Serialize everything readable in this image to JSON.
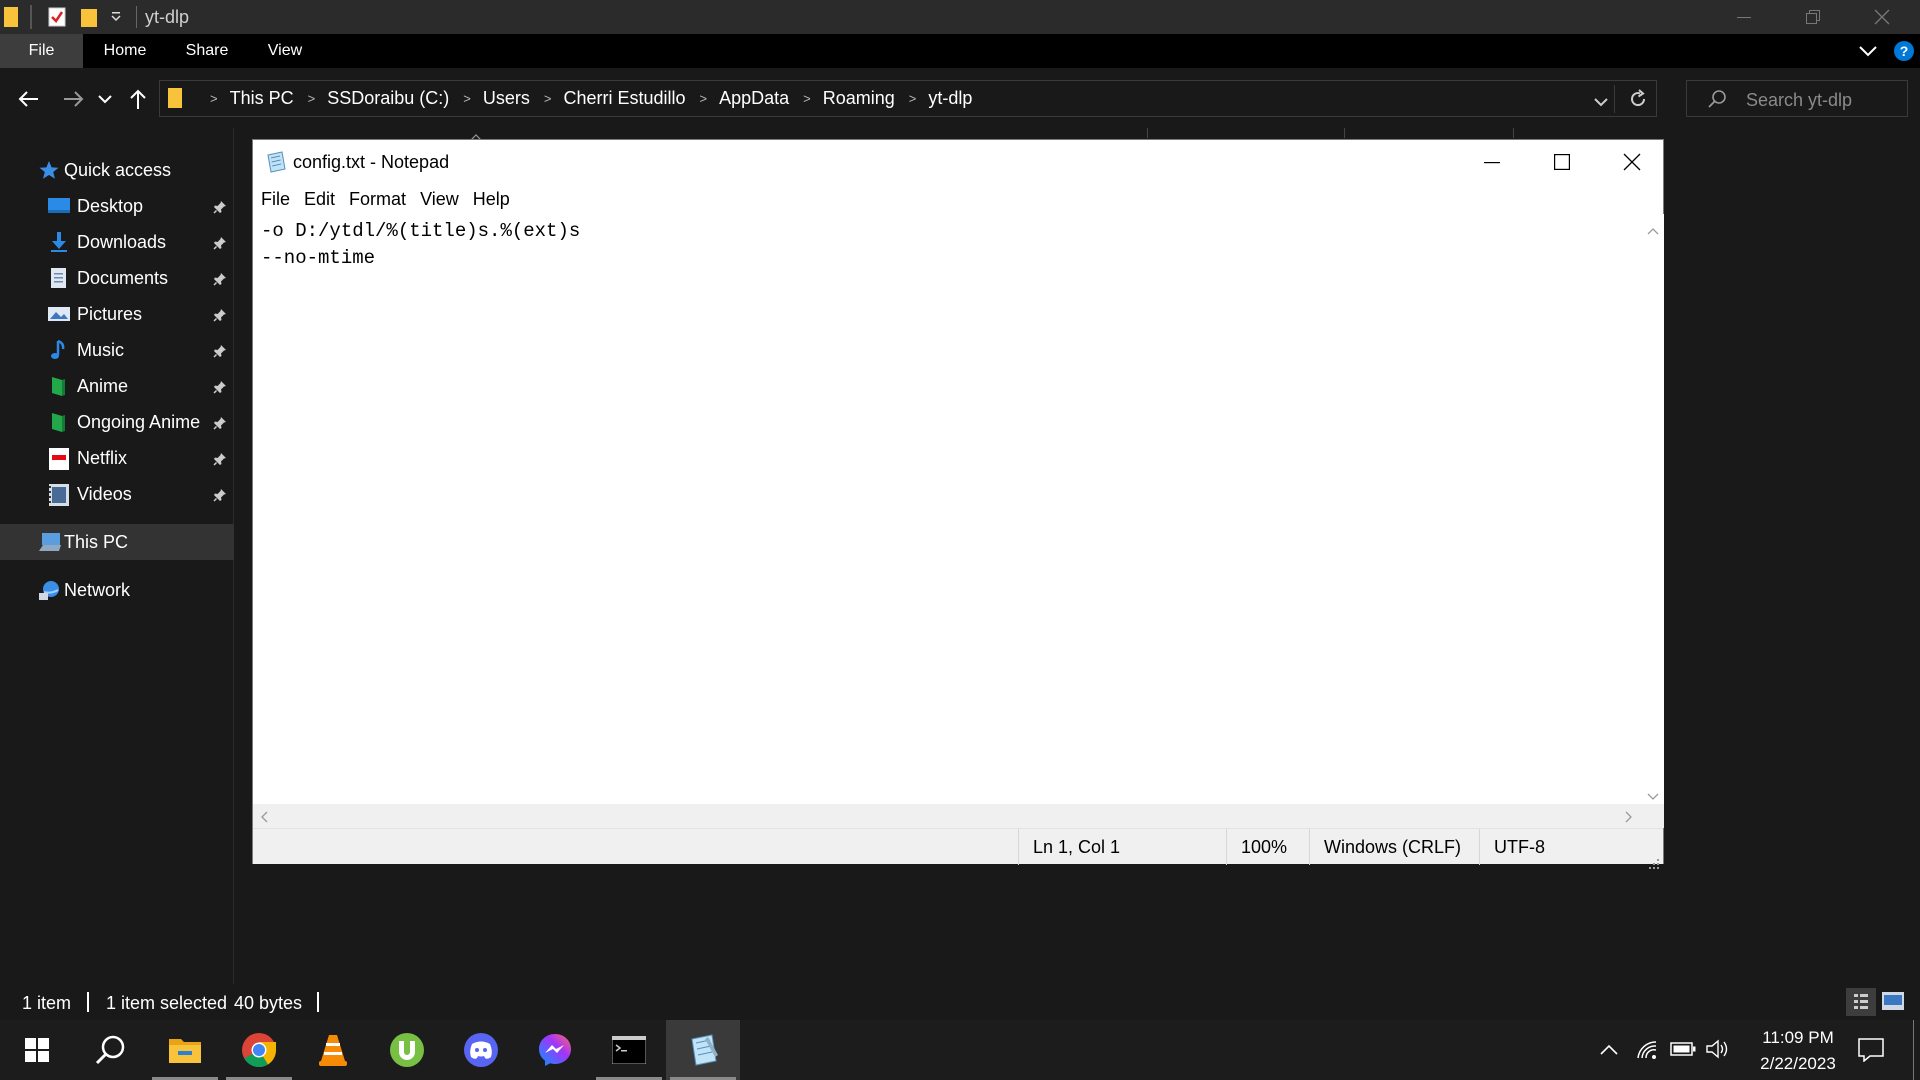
{
  "explorer": {
    "title": "yt-dlp",
    "ribbon_tabs": [
      "File",
      "Home",
      "Share",
      "View"
    ],
    "breadcrumbs": [
      "This PC",
      "SSDoraibu (C:)",
      "Users",
      "Cherri Estudillo",
      "AppData",
      "Roaming",
      "yt-dlp"
    ],
    "search_placeholder": "Search yt-dlp",
    "nav": {
      "quick_access": "Quick access",
      "items": [
        {
          "label": "Desktop",
          "icon": "desktop-icon"
        },
        {
          "label": "Downloads",
          "icon": "download-icon"
        },
        {
          "label": "Documents",
          "icon": "documents-icon"
        },
        {
          "label": "Pictures",
          "icon": "pictures-icon"
        },
        {
          "label": "Music",
          "icon": "music-icon"
        },
        {
          "label": "Anime",
          "icon": "folder-green-icon"
        },
        {
          "label": "Ongoing Anime",
          "icon": "folder-green-icon"
        },
        {
          "label": "Netflix",
          "icon": "netflix-icon"
        },
        {
          "label": "Videos",
          "icon": "videos-icon"
        }
      ],
      "this_pc": "This PC",
      "network": "Network"
    },
    "status": {
      "item_count": "1 item",
      "selected": "1 item selected",
      "size": "40 bytes"
    }
  },
  "notepad": {
    "title": "config.txt - Notepad",
    "menu": [
      "File",
      "Edit",
      "Format",
      "View",
      "Help"
    ],
    "content": "-o D:/ytdl/%(title)s.%(ext)s\n--no-mtime",
    "status": {
      "position": "Ln 1, Col 1",
      "zoom": "100%",
      "line_ending": "Windows (CRLF)",
      "encoding": "UTF-8"
    }
  },
  "taskbar": {
    "apps": [
      "windows-start-icon",
      "search-icon",
      "file-explorer-icon",
      "chrome-icon",
      "vlc-icon",
      "utorrent-icon",
      "discord-icon",
      "messenger-icon",
      "terminal-icon",
      "notepad-icon"
    ],
    "time": "11:09 PM",
    "date": "2/22/2023"
  },
  "colors": {
    "accent": "#0078d7",
    "folder": "#f8c33a",
    "dark_bg": "#191919"
  }
}
